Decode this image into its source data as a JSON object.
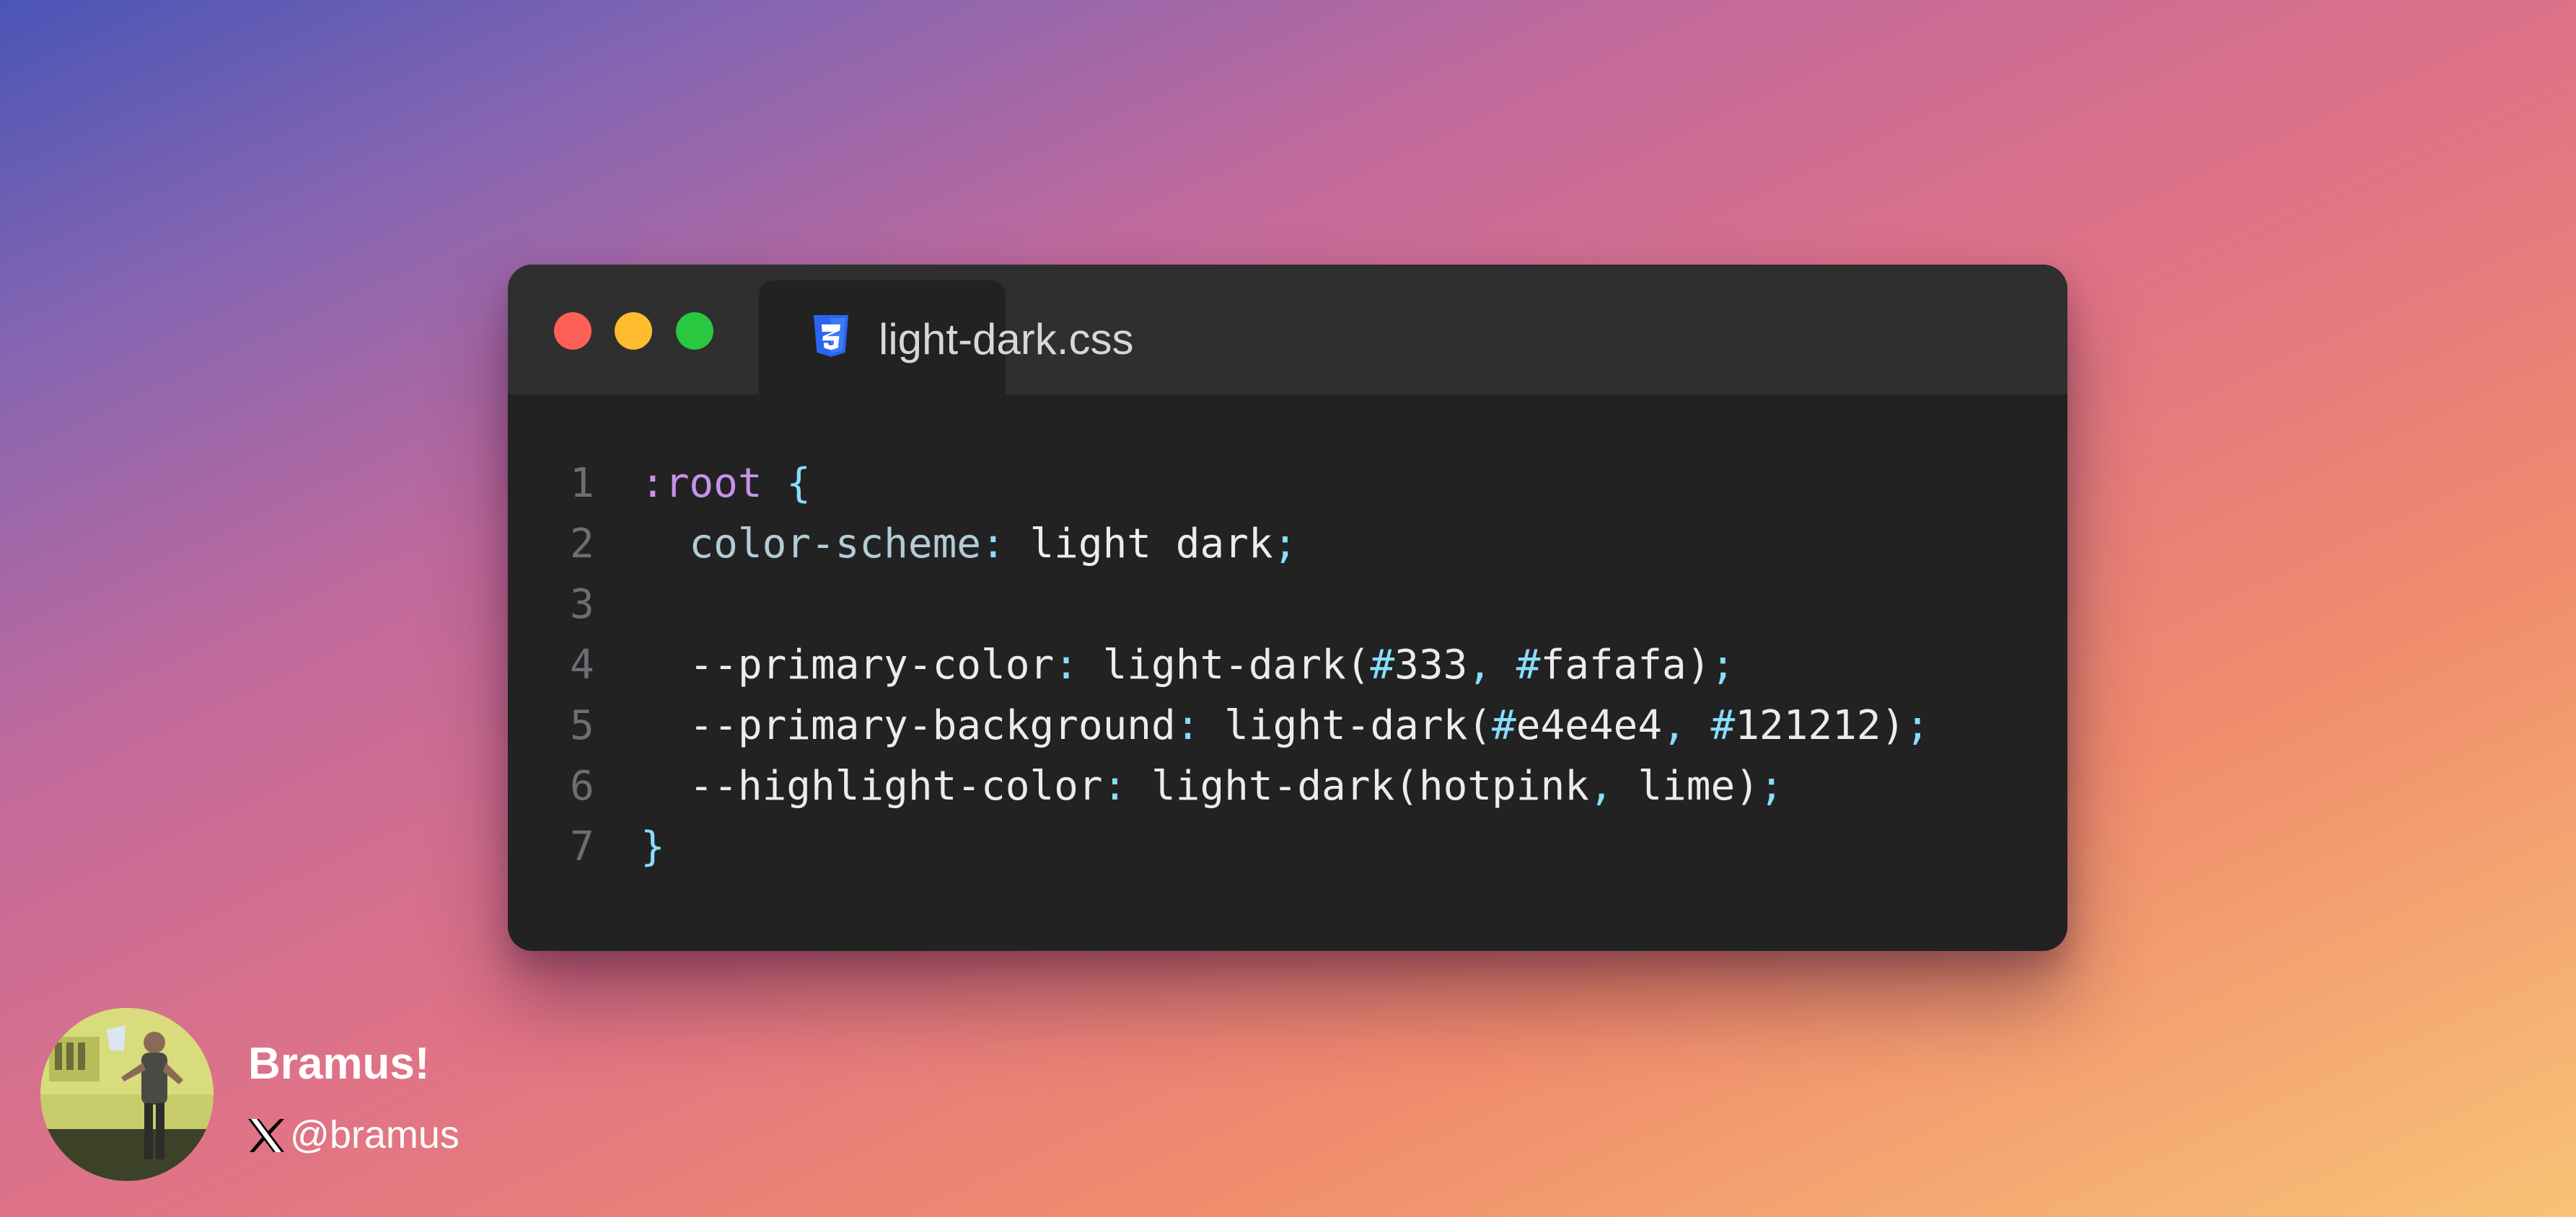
{
  "window": {
    "tab": {
      "filename": "light-dark.css",
      "icon": "css3-icon"
    }
  },
  "code": {
    "lines": [
      {
        "number": "1",
        "tokens": [
          {
            "text": ":root",
            "color": "#c792ea"
          },
          {
            "text": " ",
            "color": "#ececec"
          },
          {
            "text": "{",
            "color": "#89ddff"
          }
        ]
      },
      {
        "number": "2",
        "tokens": [
          {
            "text": "  color-scheme",
            "color": "#b2ccd6"
          },
          {
            "text": ":",
            "color": "#89ddff"
          },
          {
            "text": " light dark",
            "color": "#ececec"
          },
          {
            "text": ";",
            "color": "#89ddff"
          }
        ]
      },
      {
        "number": "3",
        "tokens": []
      },
      {
        "number": "4",
        "tokens": [
          {
            "text": "  --primary-color",
            "color": "#ececec"
          },
          {
            "text": ":",
            "color": "#89ddff"
          },
          {
            "text": " light-dark(",
            "color": "#ececec"
          },
          {
            "text": "#",
            "color": "#89ddff"
          },
          {
            "text": "333",
            "color": "#ececec"
          },
          {
            "text": ",",
            "color": "#89ddff"
          },
          {
            "text": " ",
            "color": "#ececec"
          },
          {
            "text": "#",
            "color": "#89ddff"
          },
          {
            "text": "fafafa)",
            "color": "#ececec"
          },
          {
            "text": ";",
            "color": "#89ddff"
          }
        ]
      },
      {
        "number": "5",
        "tokens": [
          {
            "text": "  --primary-background",
            "color": "#ececec"
          },
          {
            "text": ":",
            "color": "#89ddff"
          },
          {
            "text": " light-dark(",
            "color": "#ececec"
          },
          {
            "text": "#",
            "color": "#89ddff"
          },
          {
            "text": "e4e4e4",
            "color": "#ececec"
          },
          {
            "text": ",",
            "color": "#89ddff"
          },
          {
            "text": " ",
            "color": "#ececec"
          },
          {
            "text": "#",
            "color": "#89ddff"
          },
          {
            "text": "121212)",
            "color": "#ececec"
          },
          {
            "text": ";",
            "color": "#89ddff"
          }
        ]
      },
      {
        "number": "6",
        "tokens": [
          {
            "text": "  --highlight-color",
            "color": "#ececec"
          },
          {
            "text": ":",
            "color": "#89ddff"
          },
          {
            "text": " light-dark(hotpink",
            "color": "#ececec"
          },
          {
            "text": ",",
            "color": "#89ddff"
          },
          {
            "text": " lime)",
            "color": "#ececec"
          },
          {
            "text": ";",
            "color": "#89ddff"
          }
        ]
      },
      {
        "number": "7",
        "tokens": [
          {
            "text": "}",
            "color": "#89ddff"
          }
        ]
      }
    ]
  },
  "author": {
    "name": "Bramus!",
    "handle": "@bramus",
    "icon": "x-logo-icon"
  }
}
